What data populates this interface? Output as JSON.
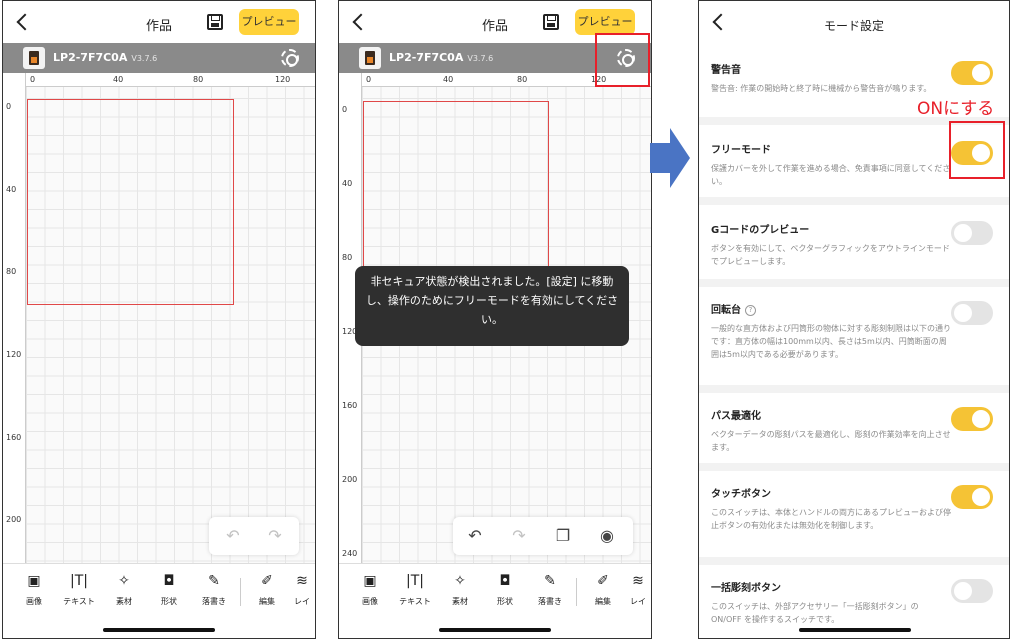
{
  "editor": {
    "title": "作品",
    "preview_label": "プレビュー",
    "device_name": "LP2-7F7C0A",
    "device_version": "V3.7.6",
    "ruler_x": [
      "0",
      "40",
      "80",
      "120"
    ],
    "ruler_y_panel1": [
      "0",
      "40",
      "80",
      "120",
      "160",
      "200"
    ],
    "ruler_y_panel2": [
      "0",
      "40",
      "80",
      "120",
      "160",
      "200",
      "240"
    ],
    "tools": [
      {
        "label": "画像",
        "icon": "image-icon"
      },
      {
        "label": "テキスト",
        "icon": "text-icon"
      },
      {
        "label": "素材",
        "icon": "material-icon"
      },
      {
        "label": "形状",
        "icon": "shape-icon"
      },
      {
        "label": "落書き",
        "icon": "doodle-icon"
      },
      {
        "label": "編集",
        "icon": "edit-icon"
      },
      {
        "label": "レイ",
        "icon": "layer-icon"
      }
    ],
    "toast_message": "非セキュア状態が検出されました。[設定] に移動し、操作のためにフリーモードを有効にしてください。"
  },
  "settings": {
    "title": "モード設定",
    "annotation": "ONにする",
    "items": [
      {
        "name": "警告音",
        "desc": "警告音: 作業の開始時と終了時に機械から警告音が鳴ります。",
        "on": true
      },
      {
        "name": "フリーモード",
        "desc": "保護カバーを外して作業を進める場合、免責事項に同意してください。",
        "on": true
      },
      {
        "name": "Gコードのプレビュー",
        "desc": "ボタンを有効にして、ベクターグラフィックをアウトラインモードでプレビューします。",
        "on": false
      },
      {
        "name": "回転台",
        "desc": "一般的な直方体および円筒形の物体に対する彫刻制限は以下の通りです：直方体の幅は100mm以内、長さは5m以内、円筒断面の周囲は5m以内である必要があります。",
        "on": false
      },
      {
        "name": "パス最適化",
        "desc": "ベクターデータの彫刻パスを最適化し、彫刻の作業効率を向上させます。",
        "on": true
      },
      {
        "name": "タッチボタン",
        "desc": "このスイッチは、本体とハンドルの両方にあるプレビューおよび停止ボタンの有効化または無効化を制御します。",
        "on": true
      },
      {
        "name": "一括彫刻ボタン",
        "desc": "このスイッチは、外部アクセサリー「一括彫刻ボタン」の ON/OFF を操作するスイッチです。",
        "on": false
      }
    ]
  },
  "colors": {
    "accent": "#ffd23a",
    "toggle_on": "#f5c335",
    "highlight": "#e8202a",
    "workarea": "#e04848",
    "arrow": "#4a74c4"
  }
}
